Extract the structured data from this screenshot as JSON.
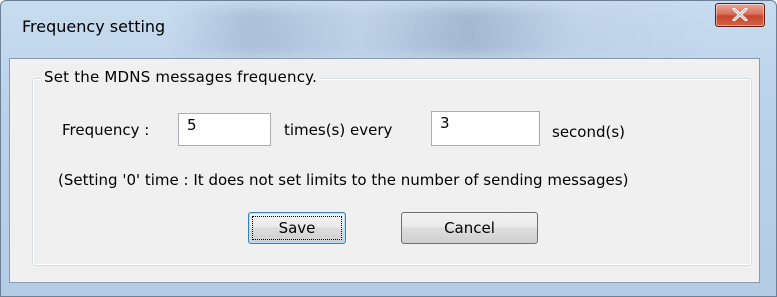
{
  "window": {
    "title": "Frequency setting",
    "close_icon": "close-icon"
  },
  "group": {
    "legend": "Set the MDNS messages frequency."
  },
  "form": {
    "frequency_label": "Frequency :",
    "frequency_value": "5",
    "times_label": "times(s) every",
    "seconds_value": "3",
    "seconds_label": "second(s)",
    "note": "(Setting '0' time : It does not set limits to the number of sending messages)"
  },
  "buttons": {
    "save_label": "Save",
    "cancel_label": "Cancel"
  }
}
